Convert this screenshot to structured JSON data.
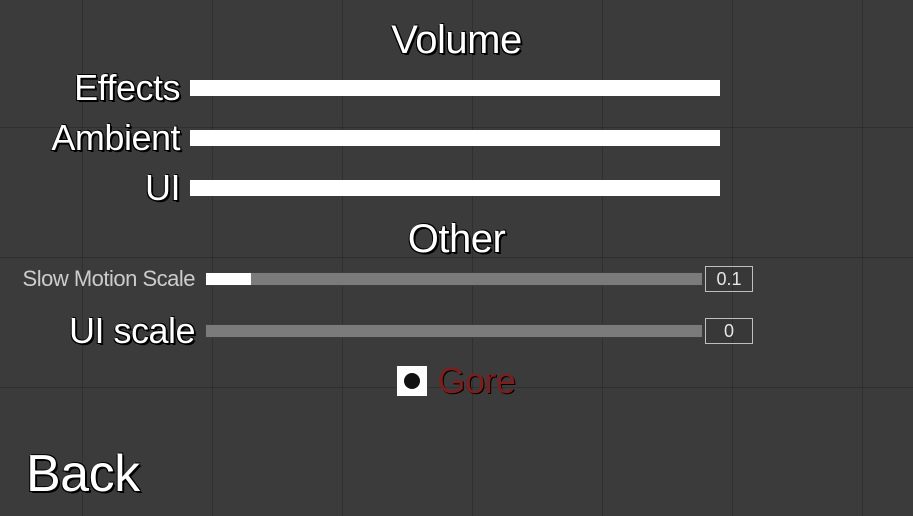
{
  "sections": {
    "volume": {
      "title": "Volume",
      "sliders": [
        {
          "label": "Effects",
          "value": 1.0
        },
        {
          "label": "Ambient",
          "value": 1.0
        },
        {
          "label": "UI",
          "value": 1.0
        }
      ]
    },
    "other": {
      "title": "Other",
      "slow_motion": {
        "label": "Slow Motion Scale",
        "value_text": "0.1",
        "fill_pct": 9
      },
      "ui_scale": {
        "label": "UI scale",
        "value_text": "0",
        "fill_pct": 0
      },
      "gore": {
        "label": "Gore",
        "checked": true
      }
    }
  },
  "back_label": "Back"
}
